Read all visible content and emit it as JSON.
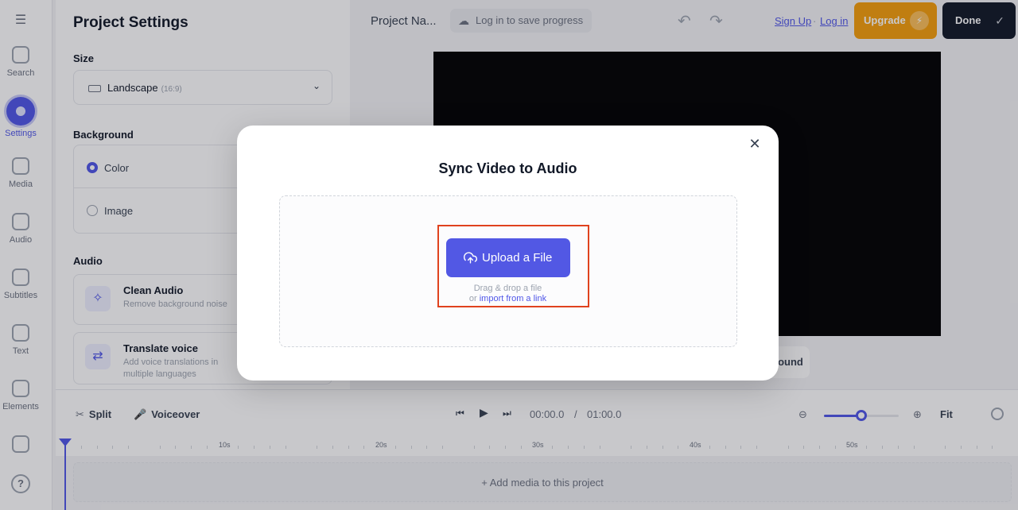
{
  "rail": {
    "items": [
      {
        "label": "Search",
        "icon": "search-icon"
      },
      {
        "label": "Settings",
        "icon": "settings-icon"
      },
      {
        "label": "Media",
        "icon": "media-icon"
      },
      {
        "label": "Audio",
        "icon": "audio-icon"
      },
      {
        "label": "Subtitles",
        "icon": "subtitles-icon"
      },
      {
        "label": "Text",
        "icon": "text-icon"
      },
      {
        "label": "Elements",
        "icon": "elements-icon"
      }
    ],
    "active": "Settings"
  },
  "panel": {
    "title": "Project Settings",
    "size_heading": "Size",
    "size_value": "Landscape",
    "size_ratio": "(16:9)",
    "background_heading": "Background",
    "bg_options": [
      "Color",
      "Image"
    ],
    "bg_selected": "Color",
    "audio_heading": "Audio",
    "audio_cards": [
      {
        "title": "Clean Audio",
        "desc": "Remove background noise"
      },
      {
        "title": "Translate voice",
        "desc": "Add voice translations in multiple languages"
      }
    ]
  },
  "topbar": {
    "project_name": "Project Na...",
    "save_label": "Log in to save progress",
    "signup": "Sign Up",
    "separator": "·",
    "login": "Log in",
    "upgrade": "Upgrade",
    "done": "Done"
  },
  "canvas": {
    "background_button": "ound"
  },
  "timeline": {
    "split": "Split",
    "voiceover": "Voiceover",
    "current_time": "00:00.0",
    "time_sep": "/",
    "total_time": "01:00.0",
    "fit": "Fit",
    "zoom_level": 0.5,
    "ticks": [
      "10s",
      "20s",
      "30s",
      "40s",
      "50s"
    ],
    "add_media": "+ Add media to this project"
  },
  "modal": {
    "title": "Sync Video to Audio",
    "upload_label": "Upload a File",
    "hint": "Drag & drop a file",
    "hint_or": "or",
    "import_link": "import from a link"
  },
  "colors": {
    "accent": "#5258e4",
    "upgrade": "#f59e0b",
    "done": "#111827",
    "highlight": "#e0421e"
  }
}
